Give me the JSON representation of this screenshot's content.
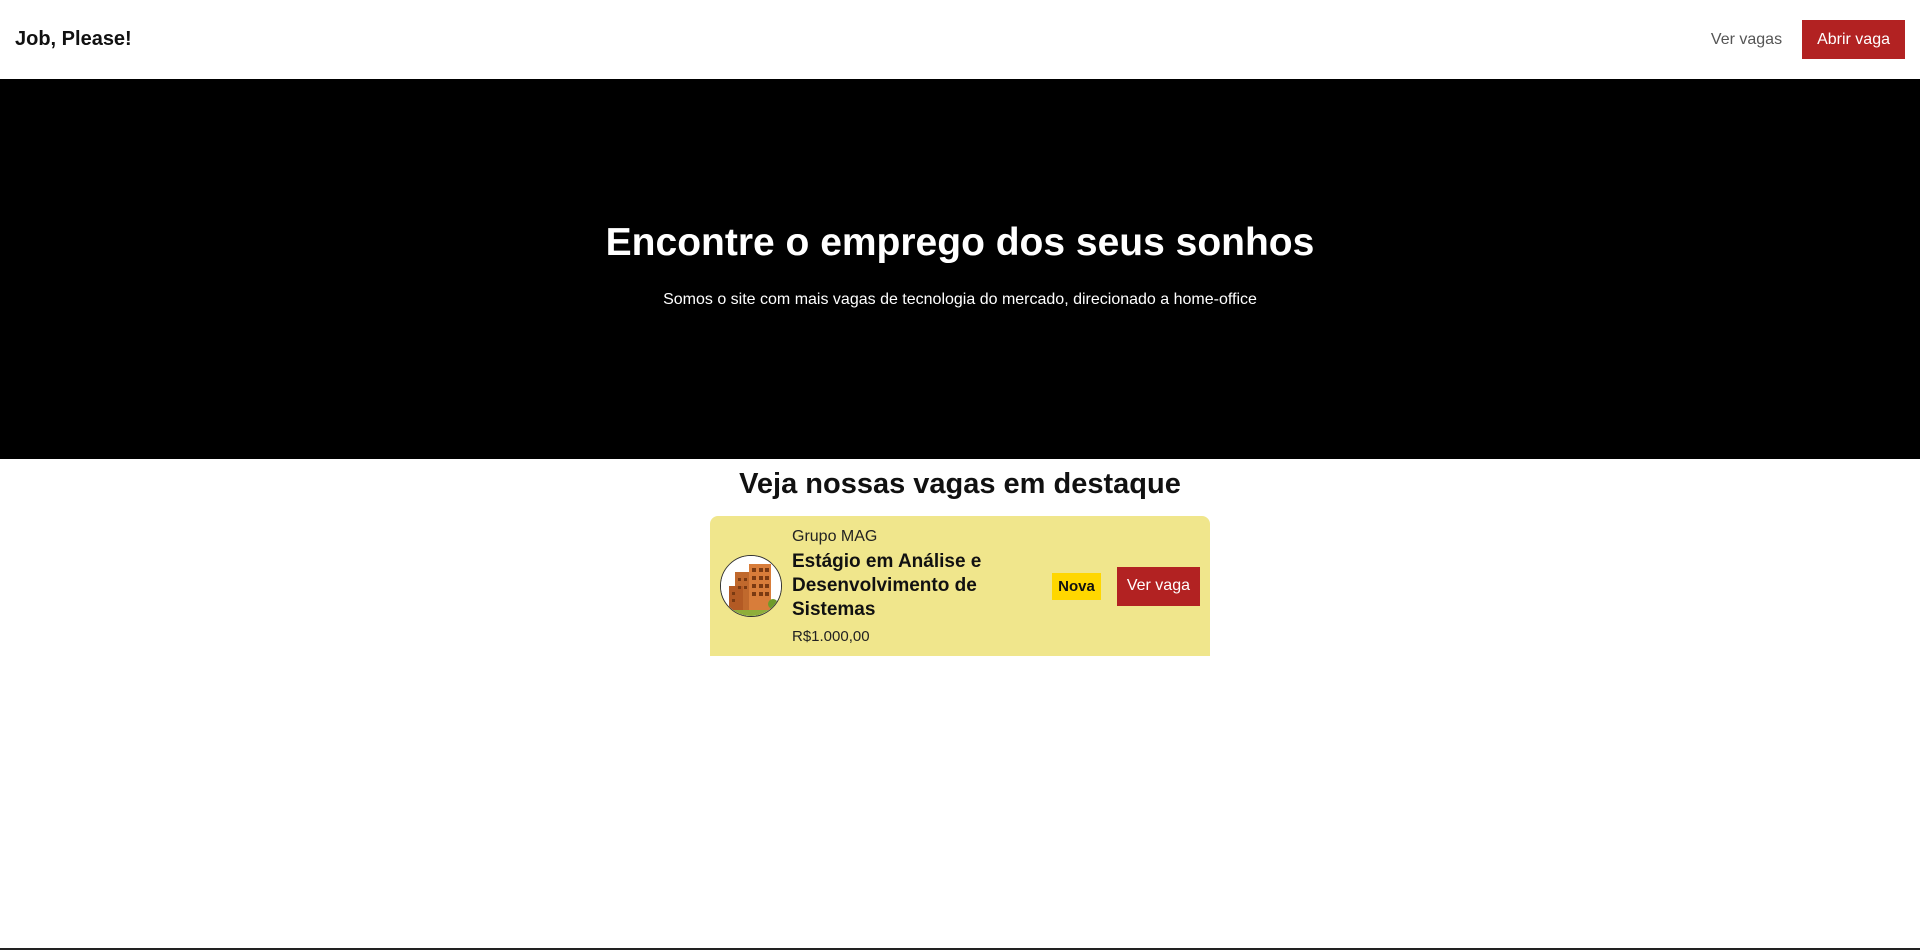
{
  "header": {
    "brand": "Job, Please!",
    "nav_link": "Ver vagas",
    "cta": "Abrir vaga"
  },
  "hero": {
    "title": "Encontre o emprego dos seus sonhos",
    "subtitle": "Somos o site com mais vagas de tecnologia do mercado, direcionado a home-office"
  },
  "featured": {
    "title": "Veja nossas vagas em destaque",
    "jobs": [
      {
        "company": "Grupo MAG",
        "title": "Estágio em Análise e Desenvolvimento de Sistemas",
        "salary": "R$1.000,00",
        "badge": "Nova",
        "button": "Ver vaga",
        "logo_icon": "building-icon"
      }
    ]
  },
  "colors": {
    "accent": "#b22222",
    "card_bg": "#f0e68c",
    "badge_bg": "#ffd700",
    "hero_bg": "#000000"
  }
}
